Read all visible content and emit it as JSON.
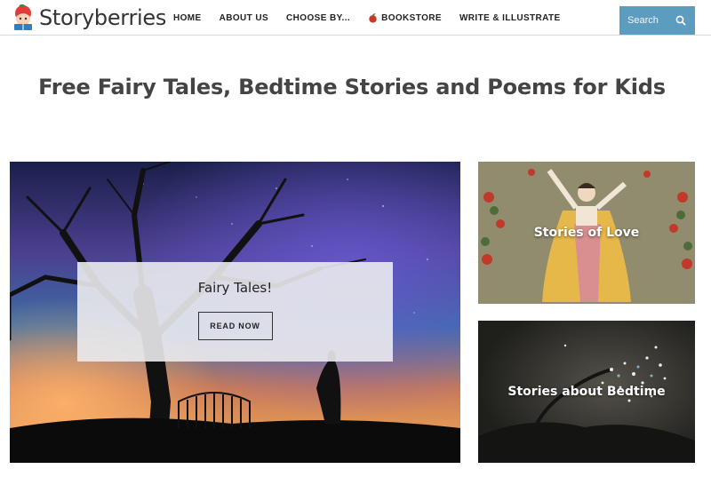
{
  "site": {
    "name": "Storyberries",
    "colors": {
      "accent": "#5b9cbf",
      "logo_red": "#e23b3b"
    }
  },
  "nav": {
    "items": [
      {
        "label": "HOME"
      },
      {
        "label": "ABOUT US"
      },
      {
        "label": "CHOOSE BY..."
      },
      {
        "label": "BOOKSTORE",
        "icon": "apple-icon"
      },
      {
        "label": "WRITE & ILLUSTRATE"
      }
    ]
  },
  "search": {
    "placeholder": "Search",
    "icon": "search-icon"
  },
  "page": {
    "title": "Free Fairy Tales, Bedtime Stories and Poems for Kids"
  },
  "hero": {
    "title": "Fairy Tales!",
    "button_label": "READ NOW"
  },
  "cards": [
    {
      "label": "Stories of Love"
    },
    {
      "label": "Stories about Bedtime"
    }
  ]
}
